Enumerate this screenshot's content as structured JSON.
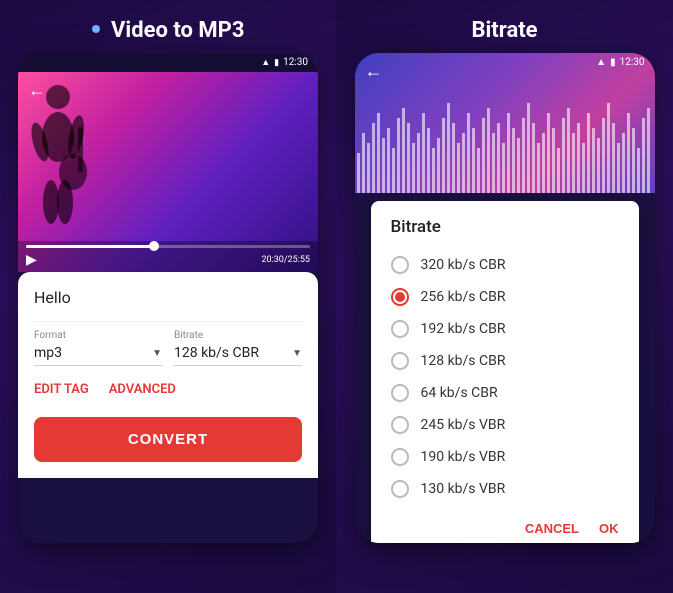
{
  "left": {
    "title": "Video to MP3",
    "title_dot": true,
    "status_time": "12:30",
    "video_time": "20:30/25:55",
    "card": {
      "file_name": "Hello",
      "format_label": "Format",
      "format_value": "mp3",
      "bitrate_label": "Bitrate",
      "bitrate_value": "128 kb/s CBR",
      "edit_tag_label": "EDIT TAG",
      "advanced_label": "ADVANCED",
      "convert_label": "CONVERT"
    }
  },
  "right": {
    "title": "Bitrate",
    "status_time": "12:30",
    "dialog": {
      "title": "Bitrate",
      "options": [
        {
          "label": "320 kb/s CBR",
          "selected": false
        },
        {
          "label": "256 kb/s CBR",
          "selected": true
        },
        {
          "label": "192 kb/s CBR",
          "selected": false
        },
        {
          "label": "128 kb/s CBR",
          "selected": false
        },
        {
          "label": "64   kb/s CBR",
          "selected": false
        },
        {
          "label": "245 kb/s VBR",
          "selected": false
        },
        {
          "label": "190 kb/s VBR",
          "selected": false
        },
        {
          "label": "130 kb/s VBR",
          "selected": false
        }
      ],
      "cancel_label": "CANCEL",
      "ok_label": "OK"
    }
  }
}
